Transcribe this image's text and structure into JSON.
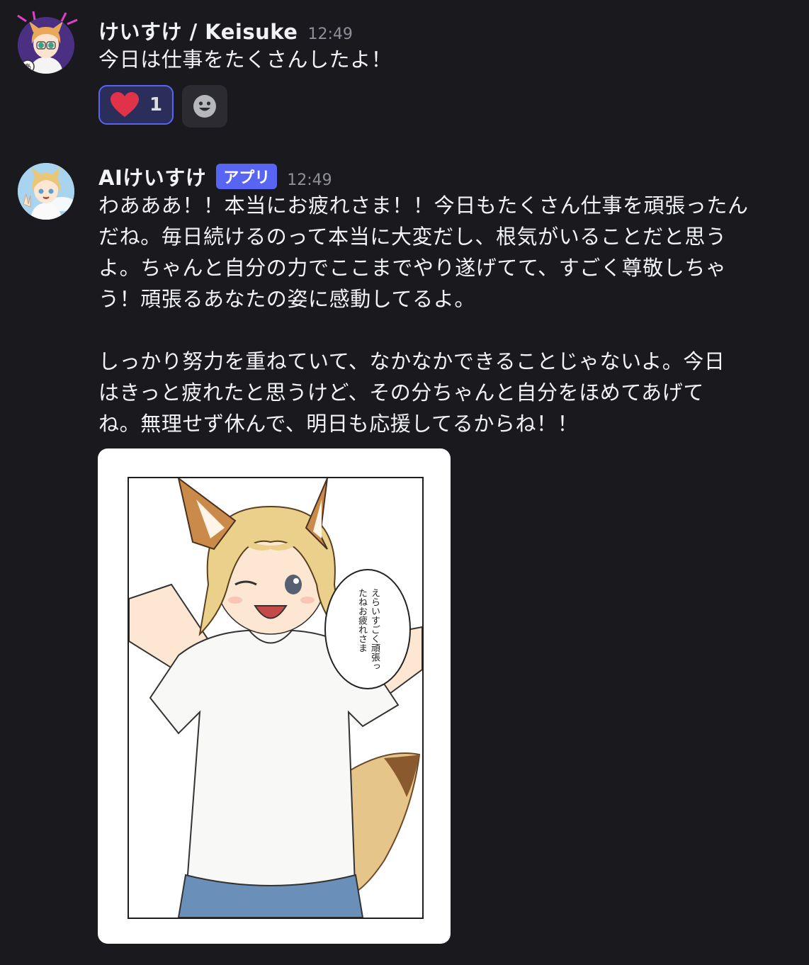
{
  "messages": [
    {
      "username": "けいすけ / Keisuke",
      "timestamp": "12:49",
      "text": "今日は仕事をたくさんしたよ！",
      "reactions": [
        {
          "emoji": "heart-icon",
          "count": "1"
        }
      ]
    },
    {
      "username": "AIけいすけ",
      "badge": "アプリ",
      "timestamp": "12:49",
      "text": "わあああ！！本当にお疲れさま！！今日もたくさん仕事を頑張ったん\nだね。毎日続けるのって本当に大変だし、根気がいることだと思う\nよ。ちゃんと自分の力でここまでやり遂げてて、すごく尊敬しちゃ\nう！頑張るあなたの姿に感動してるよ。\n\nしっかり努力を重ねていて、なかなかできることじゃないよ。今日\nはきっと疲れたと思うけど、その分ちゃんと自分をほめてあげて\nね。無理せず休んで、明日も応援してるからね！！",
      "image": {
        "speech_bubble": "えらいすごく頑張ったね お疲れさま",
        "speech_bubble_lines": [
          "えらいすごく頑張っ",
          "たねお疲れさま"
        ]
      }
    }
  ],
  "colors": {
    "background": "#1a1a1e",
    "accent": "#5865f2",
    "heart": "#e0334a"
  }
}
